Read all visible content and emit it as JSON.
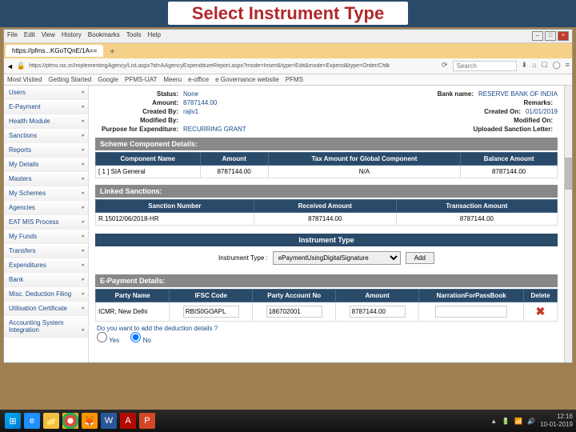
{
  "title": "Select Instrument Type",
  "menu": [
    "File",
    "Edit",
    "View",
    "History",
    "Bookmarks",
    "Tools",
    "Help"
  ],
  "tab_title": "https://pfms...KGoTQnE/1A==",
  "url": "https://pfms.nic.in/ImplementingAgency/List.aspx?id=AAgencyExpenditureReport.aspx?mode=Insert&type=Edit&mode=Expend&type=Order/Cfdk",
  "search_ph": "Search",
  "bookmarks": [
    "Most Visited",
    "Getting Started",
    "Google",
    "PFMS-UAT",
    "Meeru",
    "e-office",
    "e Governance website",
    "PFMS"
  ],
  "sidebar": [
    "Users",
    "E-Payment",
    "Health Module",
    "Sanctions",
    "Reports",
    "My Details",
    "Masters",
    "My Schemes",
    "Agencies",
    "EAT MIS Process",
    "My Funds",
    "Transfers",
    "Expenditures",
    "Bank",
    "Misc. Deduction Filing",
    "Utilisation Certificate",
    "Accounting System Integration"
  ],
  "info": {
    "status_l": "Status:",
    "status": "None",
    "bank_l": "Bank name:",
    "bank": "RESERVE BANK OF INDIA",
    "amount_l": "Amount:",
    "amount": "8787144.00",
    "remarks_l": "Remarks:",
    "created_by_l": "Created By:",
    "created_by": "rajiv1",
    "created_on_l": "Created On:",
    "created_on": "01/01/2019",
    "mod_by_l": "Modified By:",
    "mod_on_l": "Modified On:",
    "purpose_l": "Purpose for Expenditure:",
    "purpose": "RECURRING GRANT",
    "sanction_l": "Uploaded Sanction Letter:"
  },
  "sect_scheme": "Scheme Component Details:",
  "scheme_cols": [
    "Component Name",
    "Amount",
    "Tax Amount for Global Component",
    "Balance Amount"
  ],
  "scheme_row": [
    "[ 1 ] SIA General",
    "8787144.00",
    "N/A",
    "8787144.00"
  ],
  "sect_linked": "Linked Sanctions:",
  "linked_cols": [
    "Sanction Number",
    "Received Amount",
    "Transaction Amount"
  ],
  "linked_row": [
    "R.15012/06/2018-HR",
    "8787144.00",
    "8787144.00"
  ],
  "sect_instr": "Instrument Type",
  "instr_label": "Instrument Type :",
  "instr_value": "ePaymentUsingDigitalSignature",
  "btn_add": "Add",
  "sect_epay": "E-Payment Details:",
  "epay_cols": [
    "Party Name",
    "IFSC Code",
    "Party Account No",
    "Amount",
    "NarrationForPassBook",
    "Delete"
  ],
  "epay_row": {
    "party": "ICMR, New Delhi",
    "ifsc": "RBIS0GOAPL",
    "acct": "186702001",
    "amt": "8787144.00"
  },
  "question": "Do you want to add the deduction details ?",
  "yes": "Yes",
  "no": "No",
  "clock_time": "12:16",
  "clock_date": "10-01-2019"
}
